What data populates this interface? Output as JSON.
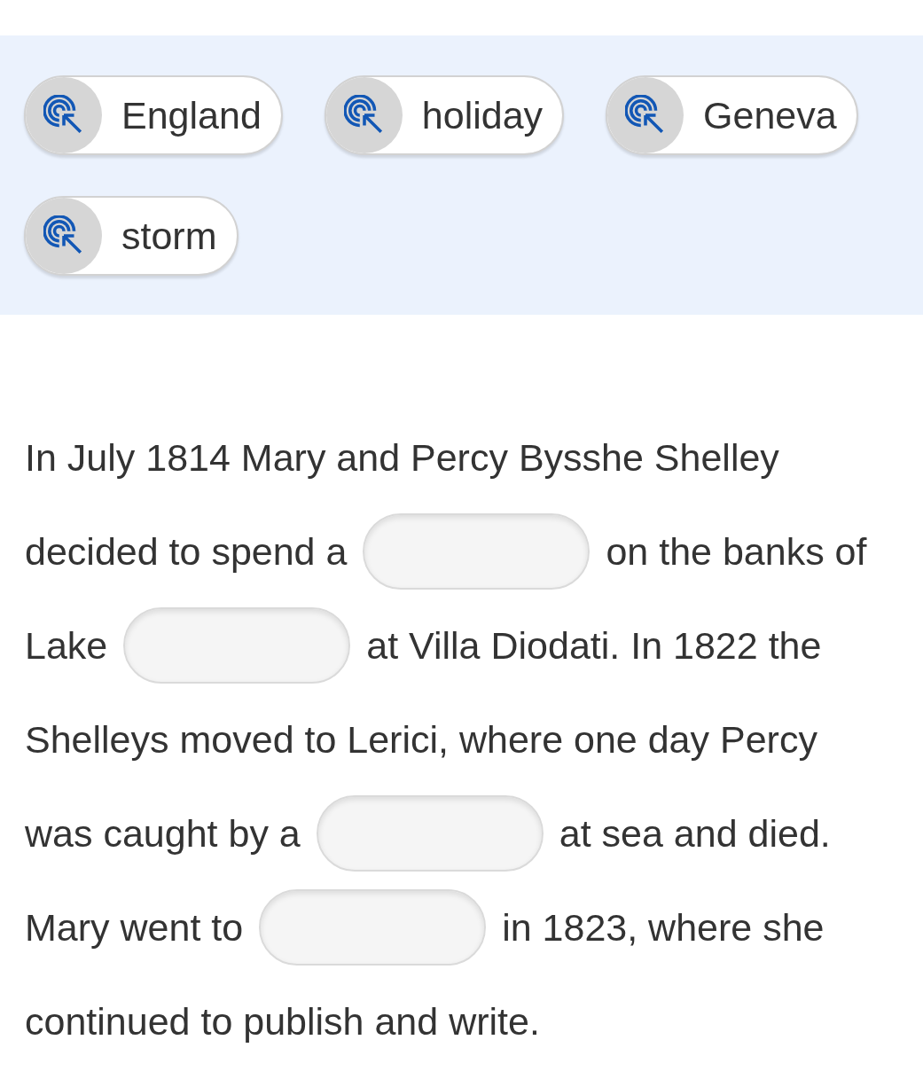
{
  "word_bank": [
    {
      "label": "England"
    },
    {
      "label": "holiday"
    },
    {
      "label": "Geneva"
    },
    {
      "label": "storm"
    }
  ],
  "passage": {
    "lines": [
      {
        "parts": [
          {
            "kind": "text",
            "text": "In July 1814 Mary and Percy Bysshe Shelley"
          }
        ]
      },
      {
        "parts": [
          {
            "kind": "text",
            "text": "decided to spend a"
          },
          {
            "kind": "blank"
          },
          {
            "kind": "text",
            "text": "on the banks of"
          }
        ]
      },
      {
        "parts": [
          {
            "kind": "text",
            "text": "Lake"
          },
          {
            "kind": "blank"
          },
          {
            "kind": "text",
            "text": "at Villa Diodati. In 1822 the"
          }
        ]
      },
      {
        "parts": [
          {
            "kind": "text",
            "text": "Shelleys moved to Lerici, where one day Percy"
          }
        ]
      },
      {
        "parts": [
          {
            "kind": "text",
            "text": "was caught by a"
          },
          {
            "kind": "blank"
          },
          {
            "kind": "text",
            "text": "at sea and died."
          }
        ]
      },
      {
        "parts": [
          {
            "kind": "text",
            "text": "Mary went to"
          },
          {
            "kind": "blank"
          },
          {
            "kind": "text",
            "text": "in 1823, where she"
          }
        ]
      },
      {
        "parts": [
          {
            "kind": "text",
            "text": "continued to publish and write."
          }
        ]
      }
    ]
  }
}
